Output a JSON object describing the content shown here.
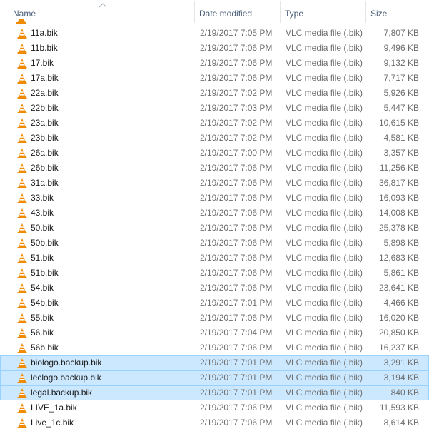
{
  "columns": {
    "name": "Name",
    "date": "Date modified",
    "type": "Type",
    "size": "Size"
  },
  "icon": "vlc-cone-icon",
  "colors": {
    "selected_bg": "#cce8ff",
    "selected_border": "#99d1ff",
    "header_text": "#4c607a",
    "vlc_orange": "#f08a00"
  },
  "files": [
    {
      "name": "11a.bik",
      "date": "2/19/2017 7:05 PM",
      "type": "VLC media file (.bik)",
      "size": "7,807 KB"
    },
    {
      "name": "11b.bik",
      "date": "2/19/2017 7:06 PM",
      "type": "VLC media file (.bik)",
      "size": "9,496 KB"
    },
    {
      "name": "17.bik",
      "date": "2/19/2017 7:06 PM",
      "type": "VLC media file (.bik)",
      "size": "9,132 KB"
    },
    {
      "name": "17a.bik",
      "date": "2/19/2017 7:06 PM",
      "type": "VLC media file (.bik)",
      "size": "7,717 KB"
    },
    {
      "name": "22a.bik",
      "date": "2/19/2017 7:02 PM",
      "type": "VLC media file (.bik)",
      "size": "5,926 KB"
    },
    {
      "name": "22b.bik",
      "date": "2/19/2017 7:03 PM",
      "type": "VLC media file (.bik)",
      "size": "5,447 KB"
    },
    {
      "name": "23a.bik",
      "date": "2/19/2017 7:02 PM",
      "type": "VLC media file (.bik)",
      "size": "10,615 KB"
    },
    {
      "name": "23b.bik",
      "date": "2/19/2017 7:02 PM",
      "type": "VLC media file (.bik)",
      "size": "4,581 KB"
    },
    {
      "name": "26a.bik",
      "date": "2/19/2017 7:00 PM",
      "type": "VLC media file (.bik)",
      "size": "3,357 KB"
    },
    {
      "name": "26b.bik",
      "date": "2/19/2017 7:06 PM",
      "type": "VLC media file (.bik)",
      "size": "11,256 KB"
    },
    {
      "name": "31a.bik",
      "date": "2/19/2017 7:06 PM",
      "type": "VLC media file (.bik)",
      "size": "36,817 KB"
    },
    {
      "name": "33.bik",
      "date": "2/19/2017 7:06 PM",
      "type": "VLC media file (.bik)",
      "size": "16,093 KB"
    },
    {
      "name": "43.bik",
      "date": "2/19/2017 7:06 PM",
      "type": "VLC media file (.bik)",
      "size": "14,008 KB"
    },
    {
      "name": "50.bik",
      "date": "2/19/2017 7:06 PM",
      "type": "VLC media file (.bik)",
      "size": "25,378 KB"
    },
    {
      "name": "50b.bik",
      "date": "2/19/2017 7:06 PM",
      "type": "VLC media file (.bik)",
      "size": "5,898 KB"
    },
    {
      "name": "51.bik",
      "date": "2/19/2017 7:06 PM",
      "type": "VLC media file (.bik)",
      "size": "12,683 KB"
    },
    {
      "name": "51b.bik",
      "date": "2/19/2017 7:06 PM",
      "type": "VLC media file (.bik)",
      "size": "5,861 KB"
    },
    {
      "name": "54.bik",
      "date": "2/19/2017 7:06 PM",
      "type": "VLC media file (.bik)",
      "size": "23,641 KB"
    },
    {
      "name": "54b.bik",
      "date": "2/19/2017 7:01 PM",
      "type": "VLC media file (.bik)",
      "size": "4,466 KB"
    },
    {
      "name": "55.bik",
      "date": "2/19/2017 7:06 PM",
      "type": "VLC media file (.bik)",
      "size": "16,020 KB"
    },
    {
      "name": "56.bik",
      "date": "2/19/2017 7:04 PM",
      "type": "VLC media file (.bik)",
      "size": "20,850 KB"
    },
    {
      "name": "56b.bik",
      "date": "2/19/2017 7:06 PM",
      "type": "VLC media file (.bik)",
      "size": "16,237 KB"
    },
    {
      "name": "biologo.backup.bik",
      "date": "2/19/2017 7:01 PM",
      "type": "VLC media file (.bik)",
      "size": "3,291 KB",
      "selected": true
    },
    {
      "name": "leclogo.backup.bik",
      "date": "2/19/2017 7:01 PM",
      "type": "VLC media file (.bik)",
      "size": "3,194 KB",
      "selected": true
    },
    {
      "name": "legal.backup.bik",
      "date": "2/19/2017 7:01 PM",
      "type": "VLC media file (.bik)",
      "size": "840 KB",
      "selected": true,
      "focused": true
    },
    {
      "name": "LIVE_1a.bik",
      "date": "2/19/2017 7:06 PM",
      "type": "VLC media file (.bik)",
      "size": "11,593 KB"
    },
    {
      "name": "Live_1c.bik",
      "date": "2/19/2017 7:06 PM",
      "type": "VLC media file (.bik)",
      "size": "8,614 KB"
    }
  ]
}
